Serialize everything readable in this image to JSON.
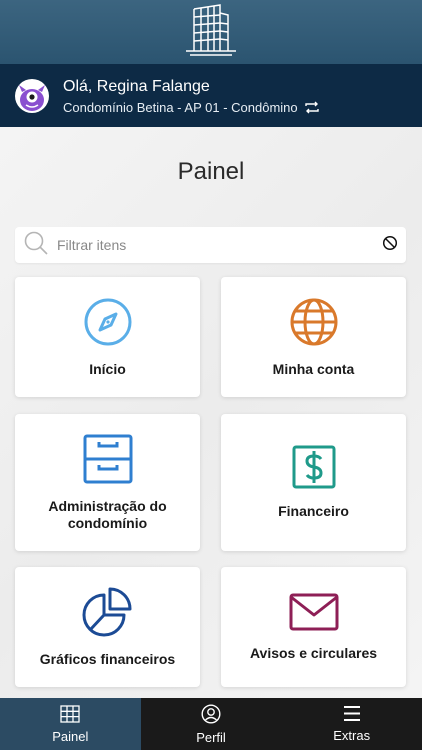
{
  "header": {
    "logo_icon": "building-icon"
  },
  "user": {
    "greeting": "Olá, Regina Falange",
    "condo": "Condomínio Betina - AP 01 - Condômino",
    "avatar_icon": "purple-monster-avatar",
    "switch_icon": "swap-icon"
  },
  "main": {
    "title": "Painel",
    "search": {
      "placeholder": "Filtrar itens",
      "value": ""
    },
    "cards": [
      {
        "label": "Início",
        "icon": "compass-icon",
        "color": "#5aaee8"
      },
      {
        "label": "Minha conta",
        "icon": "globe-icon",
        "color": "#d9792b"
      },
      {
        "label": "Administração do condomínio",
        "icon": "file-cabinet-icon",
        "color": "#2f7fd0"
      },
      {
        "label": "Financeiro",
        "icon": "dollar-icon",
        "color": "#1f9a8a"
      },
      {
        "label": "Gráficos financeiros",
        "icon": "pie-chart-icon",
        "color": "#1c4b95"
      },
      {
        "label": "Avisos e circulares",
        "icon": "envelope-icon",
        "color": "#8e1f56"
      }
    ]
  },
  "nav": {
    "items": [
      {
        "label": "Painel",
        "icon": "grid-icon"
      },
      {
        "label": "Perfil",
        "icon": "person-icon"
      },
      {
        "label": "Extras",
        "icon": "menu-icon"
      }
    ],
    "active_color": "#2c4b63"
  }
}
